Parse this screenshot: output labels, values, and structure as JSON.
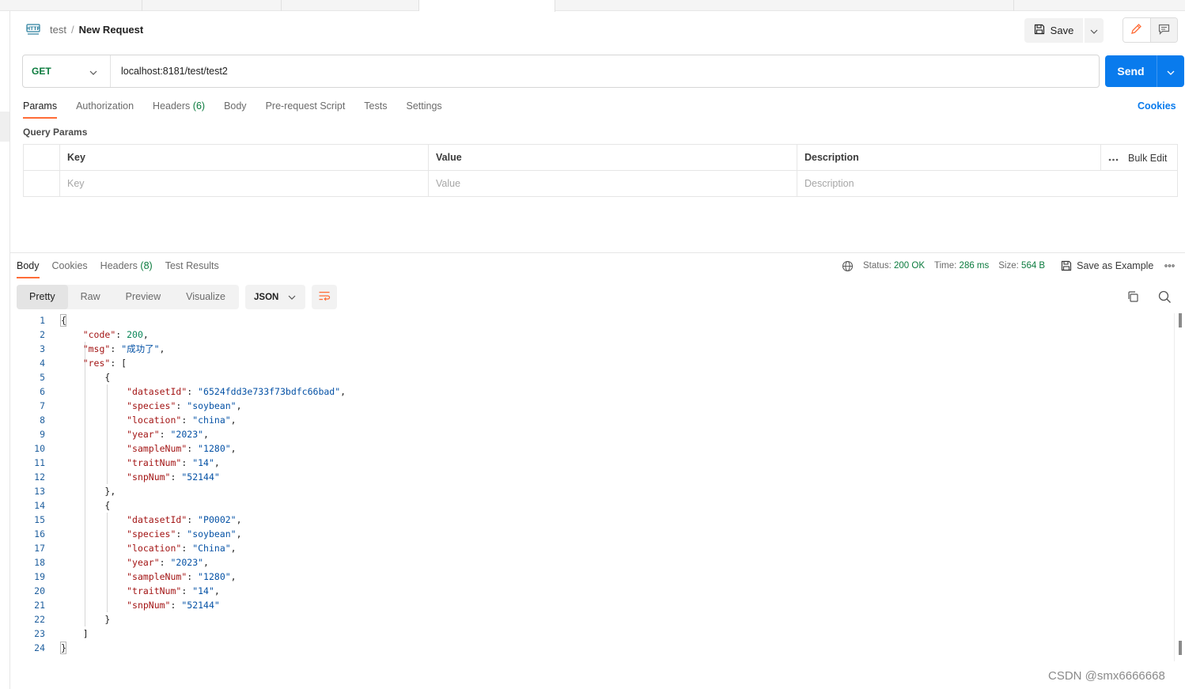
{
  "breadcrumb": {
    "parent": "test",
    "separator": "/",
    "current": "New Request"
  },
  "toolbar": {
    "save_label": "Save"
  },
  "request": {
    "method": "GET",
    "url": "localhost:8181/test/test2",
    "send_label": "Send"
  },
  "request_tabs": [
    {
      "label": "Params",
      "count": "",
      "active": true
    },
    {
      "label": "Authorization",
      "count": ""
    },
    {
      "label": "Headers",
      "count": "(6)"
    },
    {
      "label": "Body",
      "count": ""
    },
    {
      "label": "Pre-request Script",
      "count": ""
    },
    {
      "label": "Tests",
      "count": ""
    },
    {
      "label": "Settings",
      "count": ""
    }
  ],
  "cookies_label": "Cookies",
  "query_params": {
    "title": "Query Params",
    "headers": {
      "key": "Key",
      "value": "Value",
      "description": "Description"
    },
    "bulk_edit_label": "Bulk Edit",
    "placeholders": {
      "key": "Key",
      "value": "Value",
      "description": "Description"
    }
  },
  "response_tabs": [
    {
      "label": "Body",
      "count": "",
      "active": true
    },
    {
      "label": "Cookies",
      "count": ""
    },
    {
      "label": "Headers",
      "count": "(8)"
    },
    {
      "label": "Test Results",
      "count": ""
    }
  ],
  "response_meta": {
    "status_label": "Status:",
    "status_value": "200 OK",
    "time_label": "Time:",
    "time_value": "286 ms",
    "size_label": "Size:",
    "size_value": "564 B",
    "save_example_label": "Save as Example"
  },
  "view_modes": [
    "Pretty",
    "Raw",
    "Preview",
    "Visualize"
  ],
  "active_view": "Pretty",
  "format": "JSON",
  "code_lines": [
    [
      [
        "p",
        "{"
      ]
    ],
    [
      [
        "i",
        "    "
      ],
      [
        "k",
        "\"code\""
      ],
      [
        "p",
        ": "
      ],
      [
        "n",
        "200"
      ],
      [
        "p",
        ","
      ]
    ],
    [
      [
        "i",
        "    "
      ],
      [
        "k",
        "\"msg\""
      ],
      [
        "p",
        ": "
      ],
      [
        "s",
        "\"成功了\""
      ],
      [
        "p",
        ","
      ]
    ],
    [
      [
        "i",
        "    "
      ],
      [
        "k",
        "\"res\""
      ],
      [
        "p",
        ": ["
      ]
    ],
    [
      [
        "i",
        "        "
      ],
      [
        "p",
        "{"
      ]
    ],
    [
      [
        "i",
        "            "
      ],
      [
        "k",
        "\"datasetId\""
      ],
      [
        "p",
        ": "
      ],
      [
        "s",
        "\"6524fdd3e733f73bdfc66bad\""
      ],
      [
        "p",
        ","
      ]
    ],
    [
      [
        "i",
        "            "
      ],
      [
        "k",
        "\"species\""
      ],
      [
        "p",
        ": "
      ],
      [
        "s",
        "\"soybean\""
      ],
      [
        "p",
        ","
      ]
    ],
    [
      [
        "i",
        "            "
      ],
      [
        "k",
        "\"location\""
      ],
      [
        "p",
        ": "
      ],
      [
        "s",
        "\"china\""
      ],
      [
        "p",
        ","
      ]
    ],
    [
      [
        "i",
        "            "
      ],
      [
        "k",
        "\"year\""
      ],
      [
        "p",
        ": "
      ],
      [
        "s",
        "\"2023\""
      ],
      [
        "p",
        ","
      ]
    ],
    [
      [
        "i",
        "            "
      ],
      [
        "k",
        "\"sampleNum\""
      ],
      [
        "p",
        ": "
      ],
      [
        "s",
        "\"1280\""
      ],
      [
        "p",
        ","
      ]
    ],
    [
      [
        "i",
        "            "
      ],
      [
        "k",
        "\"traitNum\""
      ],
      [
        "p",
        ": "
      ],
      [
        "s",
        "\"14\""
      ],
      [
        "p",
        ","
      ]
    ],
    [
      [
        "i",
        "            "
      ],
      [
        "k",
        "\"snpNum\""
      ],
      [
        "p",
        ": "
      ],
      [
        "s",
        "\"52144\""
      ]
    ],
    [
      [
        "i",
        "        "
      ],
      [
        "p",
        "},"
      ]
    ],
    [
      [
        "i",
        "        "
      ],
      [
        "p",
        "{"
      ]
    ],
    [
      [
        "i",
        "            "
      ],
      [
        "k",
        "\"datasetId\""
      ],
      [
        "p",
        ": "
      ],
      [
        "s",
        "\"P0002\""
      ],
      [
        "p",
        ","
      ]
    ],
    [
      [
        "i",
        "            "
      ],
      [
        "k",
        "\"species\""
      ],
      [
        "p",
        ": "
      ],
      [
        "s",
        "\"soybean\""
      ],
      [
        "p",
        ","
      ]
    ],
    [
      [
        "i",
        "            "
      ],
      [
        "k",
        "\"location\""
      ],
      [
        "p",
        ": "
      ],
      [
        "s",
        "\"China\""
      ],
      [
        "p",
        ","
      ]
    ],
    [
      [
        "i",
        "            "
      ],
      [
        "k",
        "\"year\""
      ],
      [
        "p",
        ": "
      ],
      [
        "s",
        "\"2023\""
      ],
      [
        "p",
        ","
      ]
    ],
    [
      [
        "i",
        "            "
      ],
      [
        "k",
        "\"sampleNum\""
      ],
      [
        "p",
        ": "
      ],
      [
        "s",
        "\"1280\""
      ],
      [
        "p",
        ","
      ]
    ],
    [
      [
        "i",
        "            "
      ],
      [
        "k",
        "\"traitNum\""
      ],
      [
        "p",
        ": "
      ],
      [
        "s",
        "\"14\""
      ],
      [
        "p",
        ","
      ]
    ],
    [
      [
        "i",
        "            "
      ],
      [
        "k",
        "\"snpNum\""
      ],
      [
        "p",
        ": "
      ],
      [
        "s",
        "\"52144\""
      ]
    ],
    [
      [
        "i",
        "        "
      ],
      [
        "p",
        "}"
      ]
    ],
    [
      [
        "i",
        "    "
      ],
      [
        "p",
        "]"
      ]
    ],
    [
      [
        "p",
        "}"
      ]
    ]
  ],
  "watermark": "CSDN @smx6666668",
  "icons": {
    "http": "http-icon",
    "save": "save-icon",
    "edit": "pencil-icon",
    "comment": "comment-icon",
    "globe": "globe-icon",
    "copy": "copy-icon",
    "search": "search-icon",
    "wrap": "wrap-lines-icon",
    "more": "more-icon",
    "chevron": "chevron-down-icon"
  },
  "colors": {
    "accent": "#ff6c37",
    "primary": "#097bed",
    "method_get": "#0b7b3e",
    "status_ok": "#0b7b3e"
  }
}
